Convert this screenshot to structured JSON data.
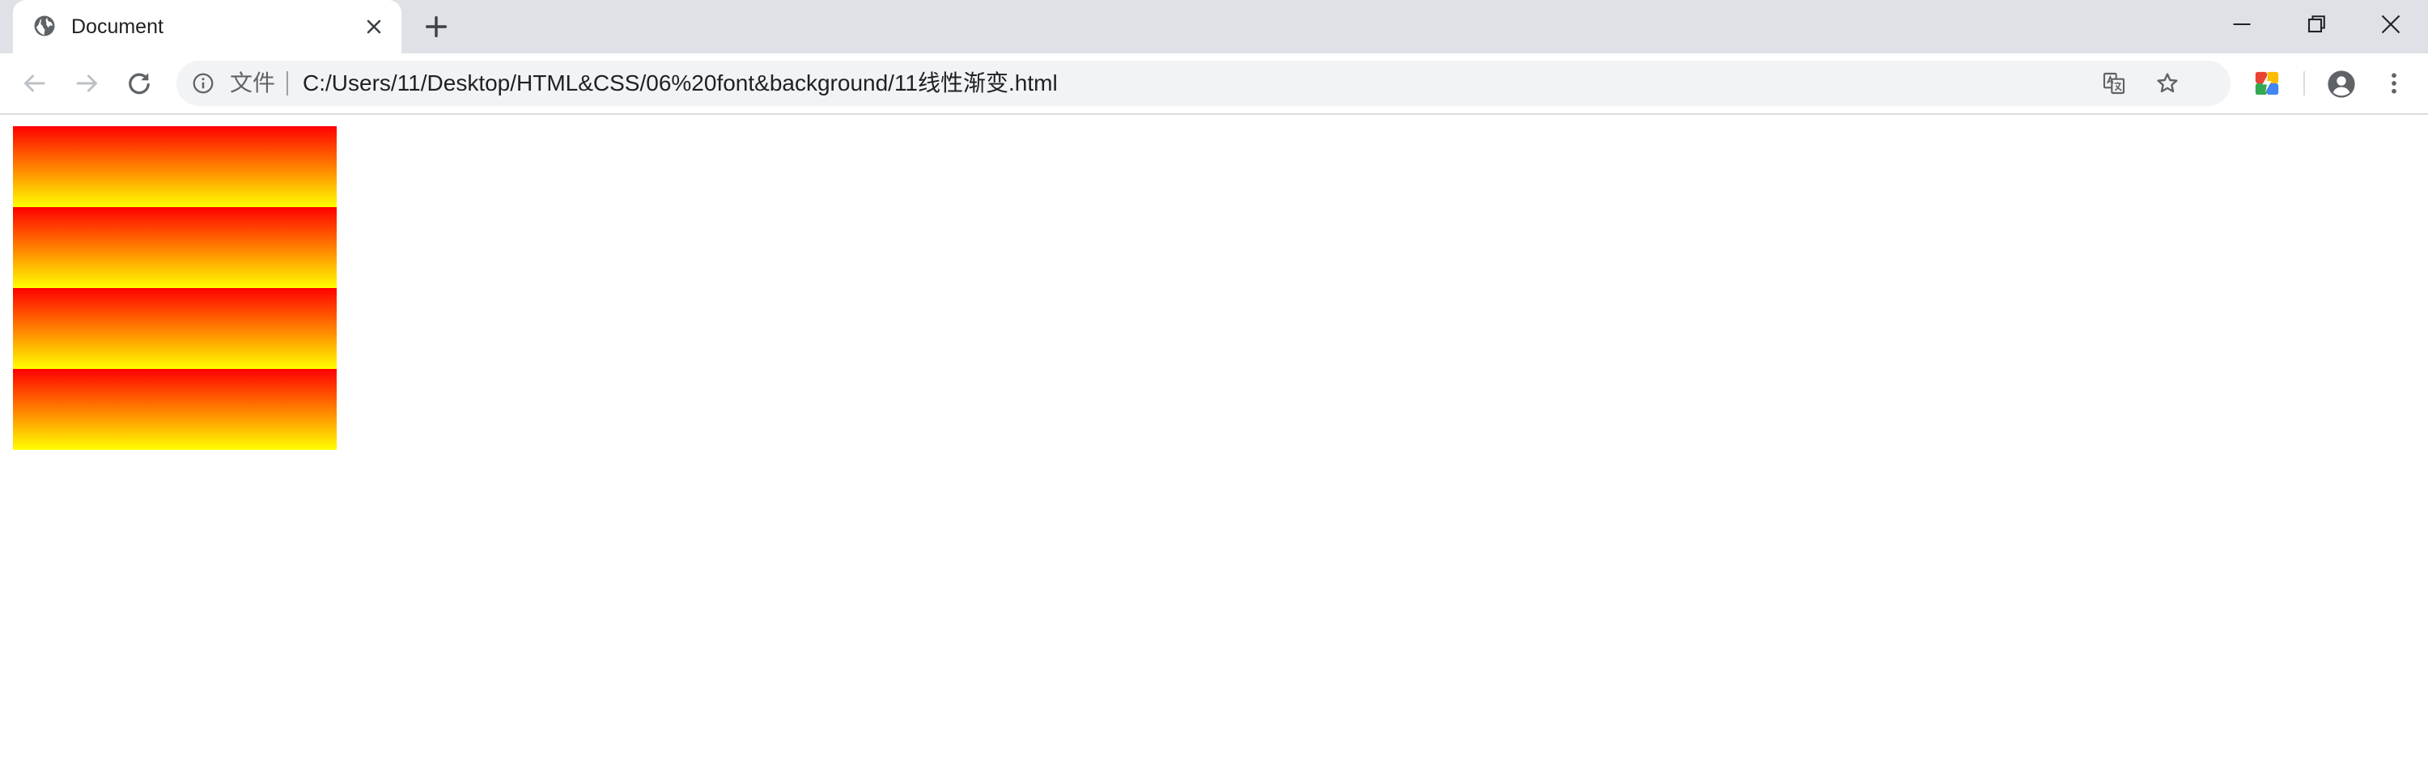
{
  "tab": {
    "title": "Document",
    "favicon": "globe-icon",
    "close_icon": "close-icon"
  },
  "tab_strip": {
    "new_tab_icon": "plus-icon"
  },
  "window_controls": {
    "minimize": "minimize-icon",
    "restore": "restore-icon",
    "close": "close-icon"
  },
  "toolbar": {
    "back_icon": "back-arrow-icon",
    "forward_icon": "forward-arrow-icon",
    "reload_icon": "reload-icon",
    "info_icon": "info-icon",
    "scheme_label": "文件",
    "url": "C:/Users/11/Desktop/HTML&CSS/06%20font&background/11线性渐变.html",
    "translate_icon": "translate-icon",
    "bookmark_icon": "star-icon",
    "extension_icon": "extension-icon",
    "profile_icon": "account-icon",
    "menu_icon": "kebab-menu-icon"
  },
  "page": {
    "gradient_colors": [
      "#ff0000",
      "#ffff00"
    ],
    "gradient_direction": "to bottom",
    "gradient_repeats": 4
  },
  "colors": {
    "tab_strip": "#dee1e6",
    "omnibox": "#f1f3f4",
    "text": "#202124",
    "icon": "#5f6368"
  }
}
